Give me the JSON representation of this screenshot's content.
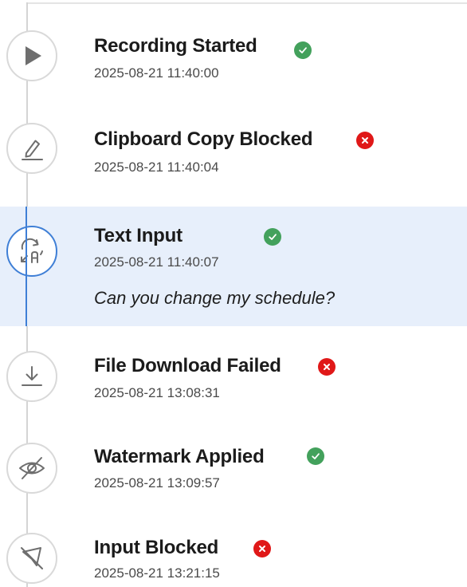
{
  "events": [
    {
      "title": "Recording Started",
      "timestamp": "2025-08-21 11:40:00",
      "status": "success",
      "icon": "play-icon"
    },
    {
      "title": "Clipboard Copy Blocked",
      "timestamp": "2025-08-21 11:40:04",
      "status": "failed",
      "icon": "pencil-icon"
    },
    {
      "title": "Text Input",
      "timestamp": "2025-08-21 11:40:07",
      "status": "success",
      "icon": "text-input-icon",
      "detail": "Can you change my schedule?",
      "selected": true
    },
    {
      "title": "File Download Failed",
      "timestamp": "2025-08-21 13:08:31",
      "status": "failed",
      "icon": "download-icon"
    },
    {
      "title": "Watermark Applied",
      "timestamp": "2025-08-21 13:09:57",
      "status": "success",
      "icon": "eye-off-icon"
    },
    {
      "title": "Input Blocked",
      "timestamp": "2025-08-21 13:21:15",
      "status": "failed",
      "icon": "cursor-off-icon"
    }
  ],
  "colors": {
    "success": "#43a15c",
    "failed": "#e01818",
    "accent": "#3f7fd6",
    "selected_background": "#e7effb"
  }
}
